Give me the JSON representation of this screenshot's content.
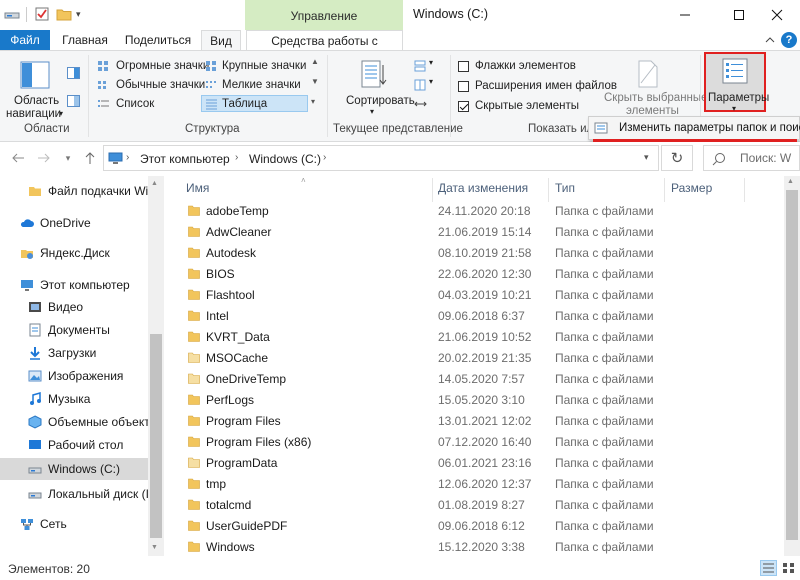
{
  "window": {
    "title": "Windows (C:)",
    "context_group": "Управление"
  },
  "tabs": {
    "file": "Файл",
    "home": "Главная",
    "share": "Поделиться",
    "view": "Вид",
    "drive_tools": "Средства работы с дисками"
  },
  "ribbon": {
    "panes": {
      "nav_pane_line1": "Область",
      "nav_pane_line2": "навигации",
      "group_label": "Области"
    },
    "layout": {
      "huge_icons": "Огромные значки",
      "large_icons": "Крупные значки",
      "medium_icons": "Обычные значки",
      "small_icons": "Мелкие значки",
      "list": "Список",
      "details": "Таблица",
      "group_label": "Структура"
    },
    "current_view": {
      "sort": "Сортировать",
      "group_label": "Текущее представление"
    },
    "show_hide": {
      "item_checkboxes": "Флажки элементов",
      "file_extensions": "Расширения имен файлов",
      "hidden_items": "Скрытые элементы",
      "item_checkboxes_checked": false,
      "file_extensions_checked": false,
      "hidden_items_checked": true,
      "hide_selected_line1": "Скрыть выбранные",
      "hide_selected_line2": "элементы",
      "group_label": "Показать или"
    },
    "options": {
      "label": "Параметры"
    }
  },
  "dropdown": {
    "change_folder_options": "Изменить параметры папок и поиска"
  },
  "address": {
    "this_pc": "Этот компьютер",
    "drive": "Windows (C:)",
    "search_placeholder": "Поиск: W"
  },
  "nav": {
    "items": [
      {
        "label": "Файл подкачки Wi",
        "icon": "folder-icon"
      },
      {
        "label": "OneDrive",
        "icon": "cloud-icon"
      },
      {
        "label": "Яндекс.Диск",
        "icon": "yandex-disk-icon"
      },
      {
        "label": "Этот компьютер",
        "icon": "computer-icon"
      },
      {
        "label": "Видео",
        "icon": "video-icon"
      },
      {
        "label": "Документы",
        "icon": "documents-icon"
      },
      {
        "label": "Загрузки",
        "icon": "downloads-icon"
      },
      {
        "label": "Изображения",
        "icon": "pictures-icon"
      },
      {
        "label": "Музыка",
        "icon": "music-icon"
      },
      {
        "label": "Объемные объект",
        "icon": "3d-objects-icon"
      },
      {
        "label": "Рабочий стол",
        "icon": "desktop-icon"
      },
      {
        "label": "Windows (C:)",
        "icon": "drive-icon"
      },
      {
        "label": "Локальный диск (I",
        "icon": "drive-icon"
      },
      {
        "label": "Сеть",
        "icon": "network-icon"
      }
    ]
  },
  "columns": {
    "name": "Имя",
    "date": "Дата изменения",
    "type": "Тип",
    "size": "Размер"
  },
  "files": [
    {
      "name": "adobeTemp",
      "date": "24.11.2020 20:18",
      "type": "Папка с файлами",
      "hidden": false
    },
    {
      "name": "AdwCleaner",
      "date": "21.06.2019 15:14",
      "type": "Папка с файлами",
      "hidden": false
    },
    {
      "name": "Autodesk",
      "date": "08.10.2019 21:58",
      "type": "Папка с файлами",
      "hidden": false
    },
    {
      "name": "BIOS",
      "date": "22.06.2020 12:30",
      "type": "Папка с файлами",
      "hidden": false
    },
    {
      "name": "Flashtool",
      "date": "04.03.2019 10:21",
      "type": "Папка с файлами",
      "hidden": false
    },
    {
      "name": "Intel",
      "date": "09.06.2018 6:37",
      "type": "Папка с файлами",
      "hidden": false
    },
    {
      "name": "KVRT_Data",
      "date": "21.06.2019 10:52",
      "type": "Папка с файлами",
      "hidden": false
    },
    {
      "name": "MSOCache",
      "date": "20.02.2019 21:35",
      "type": "Папка с файлами",
      "hidden": true
    },
    {
      "name": "OneDriveTemp",
      "date": "14.05.2020 7:57",
      "type": "Папка с файлами",
      "hidden": true
    },
    {
      "name": "PerfLogs",
      "date": "15.05.2020 3:10",
      "type": "Папка с файлами",
      "hidden": false
    },
    {
      "name": "Program Files",
      "date": "13.01.2021 12:02",
      "type": "Папка с файлами",
      "hidden": false
    },
    {
      "name": "Program Files (x86)",
      "date": "07.12.2020 16:40",
      "type": "Папка с файлами",
      "hidden": false
    },
    {
      "name": "ProgramData",
      "date": "06.01.2021 23:16",
      "type": "Папка с файлами",
      "hidden": true
    },
    {
      "name": "tmp",
      "date": "12.06.2020 12:37",
      "type": "Папка с файлами",
      "hidden": false
    },
    {
      "name": "totalcmd",
      "date": "01.08.2019 8:27",
      "type": "Папка с файлами",
      "hidden": false
    },
    {
      "name": "UserGuidePDF",
      "date": "09.06.2018 6:12",
      "type": "Папка с файлами",
      "hidden": false
    },
    {
      "name": "Windows",
      "date": "15.12.2020 3:38",
      "type": "Папка с файлами",
      "hidden": false
    }
  ],
  "status": {
    "count": "Элементов: 20"
  },
  "colors": {
    "file_tab": "#1979ca",
    "context_tab": "#d5ecc3",
    "highlight_red": "#e02020",
    "folder": "#f2c55c",
    "selection": "#cce4f7"
  }
}
